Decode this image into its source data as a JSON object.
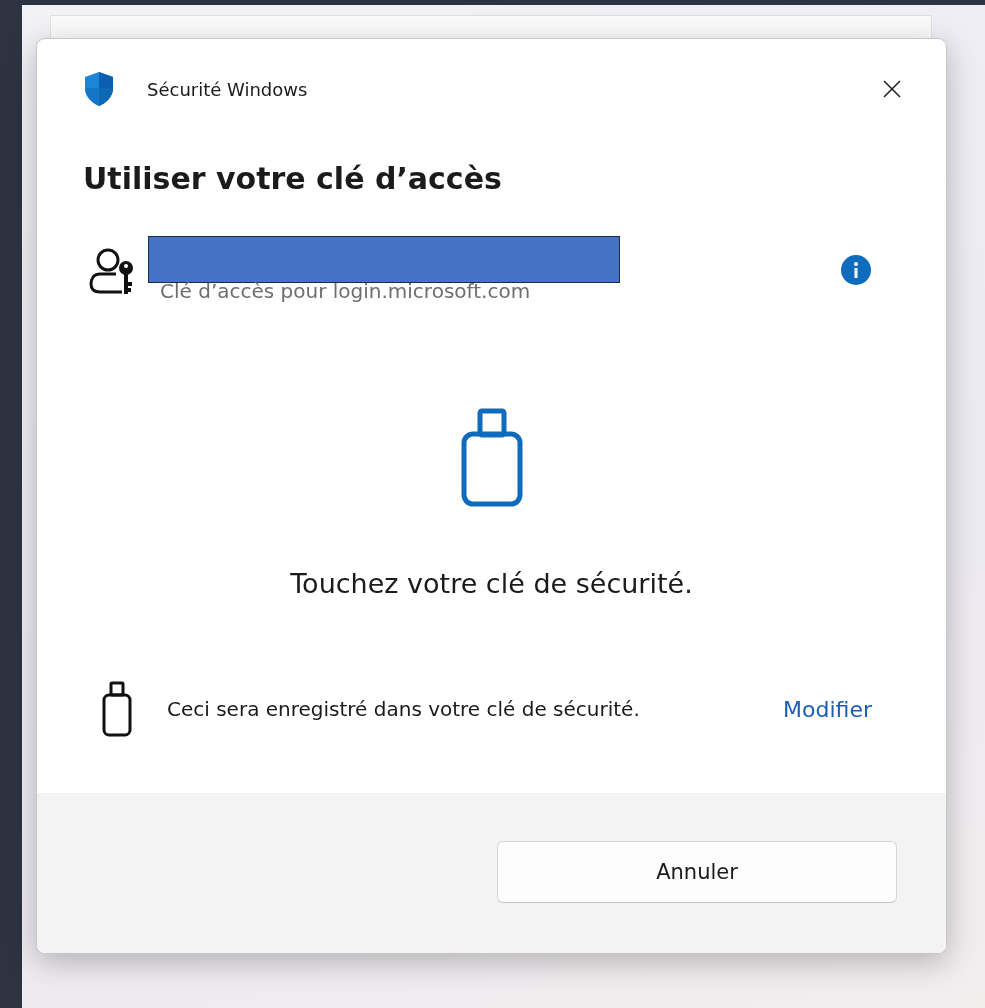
{
  "window": {
    "title": "Sécurité Windows"
  },
  "heading": "Utiliser votre clé d’accès",
  "passkey": {
    "subtitle": "Clé d’accès pour login.microsoft.com"
  },
  "prompt": "Touchez votre clé de sécurité.",
  "storage_note": {
    "text": "Ceci sera enregistré dans votre clé de sécurité.",
    "link": "Modifier"
  },
  "buttons": [
    "Annuler"
  ]
}
